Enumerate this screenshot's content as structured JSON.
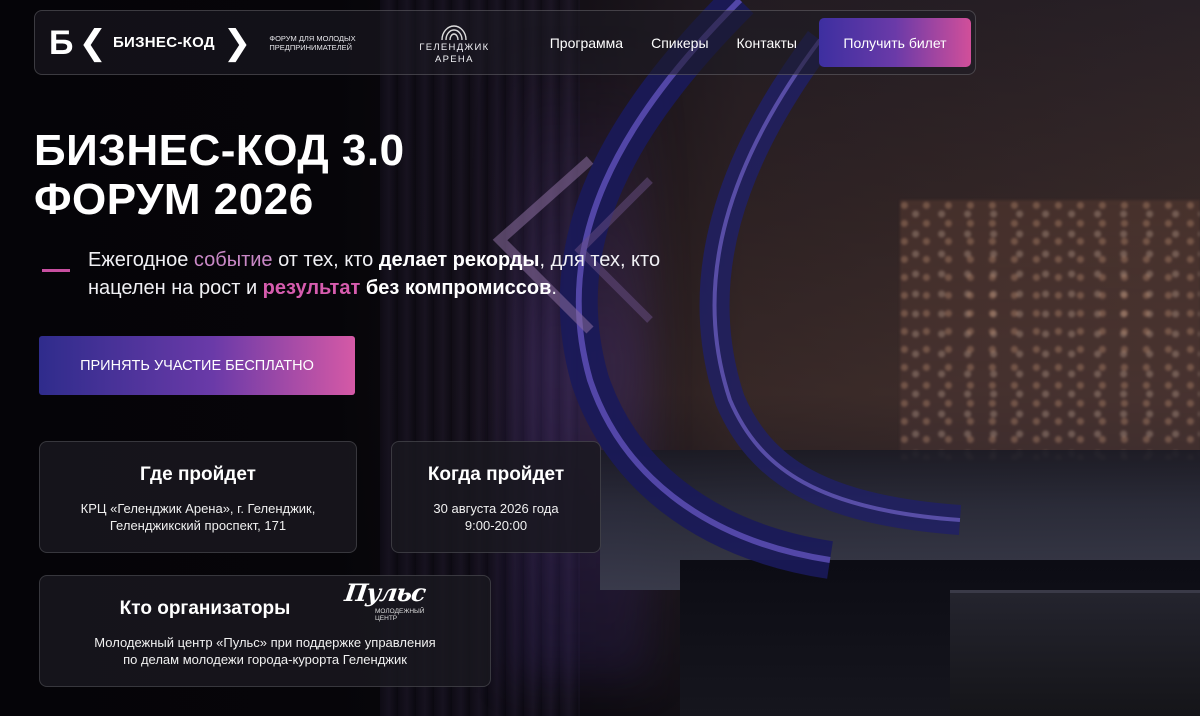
{
  "header": {
    "logo_mark": "Б",
    "logo_name": "БИЗНЕС-КОД",
    "tagline": "ФОРУМ ДЛЯ МОЛОДЫХ ПРЕДПРИНИМАТЕЛЕЙ",
    "arena_line1": "ГЕЛЕНДЖИК",
    "arena_line2": "АРЕНА",
    "nav": [
      "Программа",
      "Спикеры",
      "Контакты"
    ],
    "ticket_label": "Получить билет"
  },
  "hero": {
    "title_line1": "БИЗНЕС-КОД 3.0",
    "title_line2": "ФОРУМ 2026",
    "subtitle": {
      "p1": "Ежегодное ",
      "p2": "событие",
      "p3": " от тех, кто ",
      "p4": "делает рекорды",
      "p5": ", для тех, кто нацелен на рост и ",
      "p6": "результат",
      "p7": " ",
      "p8": "без компромиссов",
      "p9": "."
    },
    "cta_label": "ПРИНЯТЬ УЧАСТИЕ БЕСПЛАТНО"
  },
  "cards": {
    "where": {
      "title": "Где пройдет",
      "line1": "КРЦ «Геленджик Арена», г. Геленджик,",
      "line2": "Геленджикский проспект, 171"
    },
    "when": {
      "title": "Когда пройдет",
      "line1": "30 августа 2026 года",
      "line2": "9:00-20:00"
    },
    "org": {
      "title": "Кто организаторы",
      "logo_word": "Пульс",
      "logo_sub1": "МОЛОДЕЖНЫЙ",
      "logo_sub2": "ЦЕНТР",
      "line1": "Молодежный центр «Пульс» при поддержке управления",
      "line2": "по делам молодежи города-курорта Геленджик"
    }
  },
  "colors": {
    "accent_pink": "#d65cae",
    "accent_purple": "#3d2fa0",
    "background": "#07060a"
  }
}
